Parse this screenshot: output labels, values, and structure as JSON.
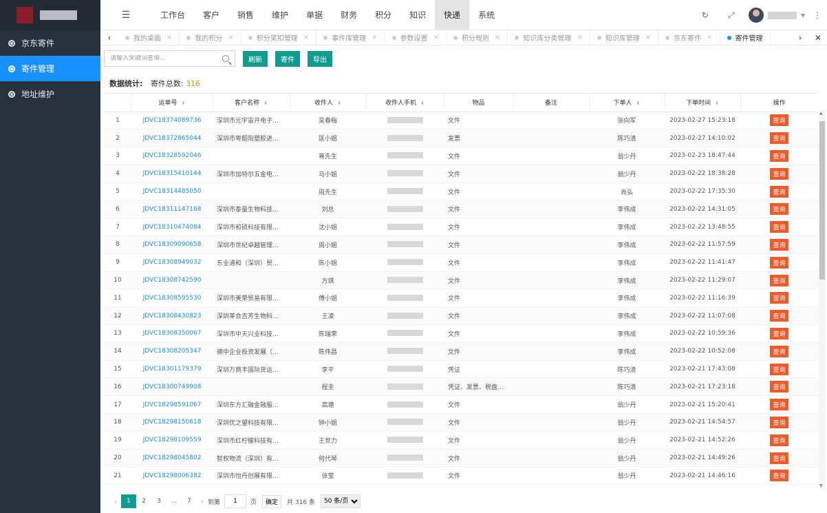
{
  "sidebar": {
    "items": [
      {
        "label": "京东寄件",
        "active": false
      },
      {
        "label": "寄件管理",
        "active": true
      },
      {
        "label": "地址维护",
        "active": false
      }
    ]
  },
  "topnav": {
    "items": [
      "工作台",
      "客户",
      "销售",
      "维护",
      "单据",
      "财务",
      "积分",
      "知识",
      "快递",
      "系统"
    ],
    "active": "快递"
  },
  "tabs": [
    {
      "label": "我的桌面",
      "active": false
    },
    {
      "label": "我的积分",
      "active": false
    },
    {
      "label": "积分奖扣管理",
      "active": false
    },
    {
      "label": "事件库管理",
      "active": false
    },
    {
      "label": "参数设置",
      "active": false
    },
    {
      "label": "积分规则",
      "active": false
    },
    {
      "label": "知识库分类管理",
      "active": false
    },
    {
      "label": "知识库管理",
      "active": false
    },
    {
      "label": "京东寄件",
      "active": false
    },
    {
      "label": "寄件管理",
      "active": true
    }
  ],
  "toolbar": {
    "search_placeholder": "请输入关键词查询...",
    "refresh_label": "刷新",
    "send_label": "寄件",
    "export_label": "导出"
  },
  "stats": {
    "label": "数据统计:",
    "total_label": "寄件总数:",
    "total_value": "316"
  },
  "table": {
    "columns": [
      "运单号",
      "客户名称",
      "收件人",
      "收件人手机",
      "物品",
      "备注",
      "下单人",
      "下单时间",
      "操作"
    ],
    "action_label": "查询",
    "rows": [
      {
        "no": "1",
        "waybill": "JDVC18374089736",
        "customer": "深圳市元宇宙开电子...",
        "recipient": "吴春梅",
        "item": "文件",
        "note": "",
        "orderer": "张向军",
        "time": "2023-02-27 15:23:18"
      },
      {
        "no": "2",
        "waybill": "JDVC18372865044",
        "customer": "深圳市粤韶阳塑胶进...",
        "recipient": "匡小姐",
        "item": "发票",
        "note": "",
        "orderer": "陈巧清",
        "time": "2023-02-27 14:10:02"
      },
      {
        "no": "3",
        "waybill": "JDVC18328592046",
        "customer": "",
        "recipient": "蒋先生",
        "item": "文件",
        "note": "",
        "orderer": "翁少丹",
        "time": "2023-02-23 18:47:44"
      },
      {
        "no": "4",
        "waybill": "JDVC18315410144",
        "customer": "深圳市加特尔五金电...",
        "recipient": "马小姐",
        "item": "文件",
        "note": "",
        "orderer": "翁少丹",
        "time": "2023-02-22 18:38:28"
      },
      {
        "no": "5",
        "waybill": "JDVC18314485050",
        "customer": "",
        "recipient": "周先生",
        "item": "文件",
        "note": "",
        "orderer": "肖弘",
        "time": "2023-02-22 17:35:30"
      },
      {
        "no": "6",
        "waybill": "JDVC18311147168",
        "customer": "深圳市泰量生物科技...",
        "recipient": "刘总",
        "item": "文件",
        "note": "",
        "orderer": "李伟成",
        "time": "2023-02-22 14:31:05"
      },
      {
        "no": "7",
        "waybill": "JDVC18310474084",
        "customer": "深圳市和硕科技有限...",
        "recipient": "沈小姐",
        "item": "文件",
        "note": "",
        "orderer": "李伟成",
        "time": "2023-02-22 13:48:55"
      },
      {
        "no": "8",
        "waybill": "JDVC18309090658",
        "customer": "深圳市世纪卓越管理...",
        "recipient": "周小姐",
        "item": "文件",
        "note": "",
        "orderer": "李伟成",
        "time": "2023-02-22 11:57:59"
      },
      {
        "no": "9",
        "waybill": "JDVC18308949032",
        "customer": "东业通和（深圳）贸...",
        "recipient": "陈小姐",
        "item": "文件",
        "note": "",
        "orderer": "李伟成",
        "time": "2023-02-22 11:41:47"
      },
      {
        "no": "10",
        "waybill": "JDVC18308742590",
        "customer": "",
        "recipient": "方琪",
        "item": "文件",
        "note": "",
        "orderer": "李伟成",
        "time": "2023-02-22 11:29:07"
      },
      {
        "no": "11",
        "waybill": "JDVC18308595530",
        "customer": "深圳市美荣贸易有限...",
        "recipient": "傅小姐",
        "item": "文件",
        "note": "",
        "orderer": "李伟成",
        "time": "2023-02-22 11:16:39"
      },
      {
        "no": "12",
        "waybill": "JDVC18308430823",
        "customer": "深圳莘合吉芳生物科...",
        "recipient": "王凌",
        "item": "文件",
        "note": "",
        "orderer": "李伟成",
        "time": "2023-02-22 11:07:08"
      },
      {
        "no": "13",
        "waybill": "JDVC18308350067",
        "customer": "深圳市中天兴业科技...",
        "recipient": "陈瑞荣",
        "item": "文件",
        "note": "",
        "orderer": "李伟成",
        "time": "2023-02-22 10:59:36"
      },
      {
        "no": "14",
        "waybill": "JDVC18308205347",
        "customer": "德中企业投资发展（...",
        "recipient": "陈伟昌",
        "item": "文件",
        "note": "",
        "orderer": "李伟成",
        "time": "2023-02-22 10:52:08"
      },
      {
        "no": "15",
        "waybill": "JDVC18301179379",
        "customer": "深圳万商丰国际货运...",
        "recipient": "李平",
        "item": "凭证",
        "note": "",
        "orderer": "陈巧清",
        "time": "2023-02-21 17:43:08"
      },
      {
        "no": "16",
        "waybill": "JDVC18300749908",
        "customer": "",
        "recipient": "程圭",
        "item": "凭证、发票、税盘公...",
        "note": "",
        "orderer": "陈巧清",
        "time": "2023-02-21 17:23:18"
      },
      {
        "no": "17",
        "waybill": "JDVC18298591067",
        "customer": "深圳东方汇融金融服...",
        "recipient": "高塘",
        "item": "文件",
        "note": "",
        "orderer": "翁少丹",
        "time": "2023-02-21 15:20:41"
      },
      {
        "no": "18",
        "waybill": "JDVC18298150618",
        "customer": "深圳优之望科技有限...",
        "recipient": "钟小姐",
        "item": "文件",
        "note": "",
        "orderer": "翁少丹",
        "time": "2023-02-21 14:54:57"
      },
      {
        "no": "19",
        "waybill": "JDVC18298109559",
        "customer": "深圳市红柠檬科技有...",
        "recipient": "王世力",
        "item": "文件",
        "note": "",
        "orderer": "翁少丹",
        "time": "2023-02-21 14:52:26"
      },
      {
        "no": "20",
        "waybill": "JDVC18298045802",
        "customer": "智权物流（深圳）有...",
        "recipient": "何代琴",
        "item": "文件",
        "note": "",
        "orderer": "翁少丹",
        "time": "2023-02-21 14:49:26"
      },
      {
        "no": "21",
        "waybill": "JDVC18298006382",
        "customer": "深圳市怡丹创展有限...",
        "recipient": "张莹",
        "item": "文件",
        "note": "",
        "orderer": "翁少丹",
        "time": "2023-02-21 14:46:16"
      }
    ]
  },
  "pagination": {
    "pages": [
      "1",
      "2",
      "3",
      "...",
      "7"
    ],
    "current": "1",
    "goto_label": "到第",
    "goto_value": "1",
    "page_unit": "页",
    "confirm_label": "确定",
    "total_label": "共 316 条",
    "page_size": "50 条/页"
  }
}
